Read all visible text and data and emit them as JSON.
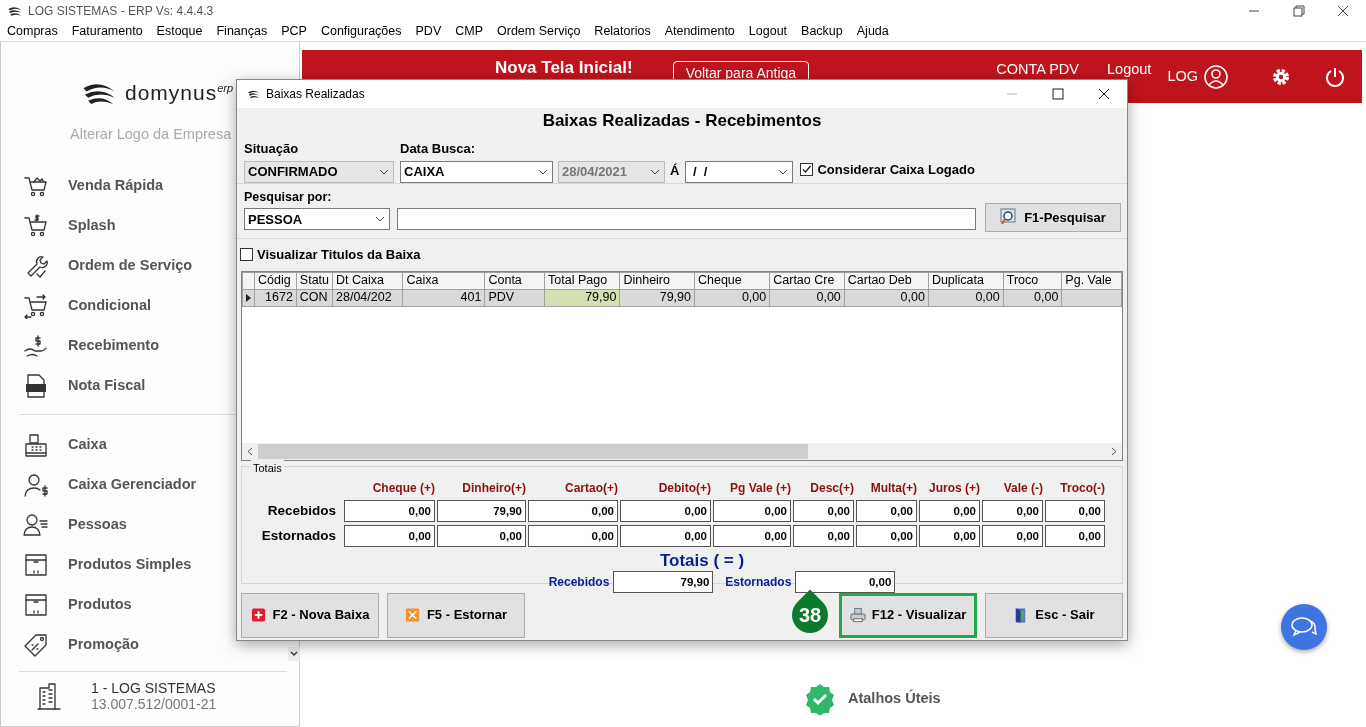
{
  "app_window": {
    "title": "LOG SISTEMAS - ERP Vs: 4.4.4.3"
  },
  "menu": [
    "Compras",
    "Faturamento",
    "Estoque",
    "Finanças",
    "PCP",
    "Configurações",
    "PDV",
    "CMP",
    "Ordem Serviço",
    "Relatorios",
    "Atendimento",
    "Logout",
    "Backup",
    "Ajuda"
  ],
  "header": {
    "banner": "Nova Tela Inicial!",
    "back_button": "Voltar para Antiga",
    "account": "CONTA PDV",
    "logout": "Logout",
    "user": "LOG"
  },
  "sidebar": {
    "logo": "domynus",
    "logo_suffix": "erp",
    "change_logo": "Alterar Logo da Empresa",
    "groups": [
      [
        "Venda Rápida",
        "Splash",
        "Ordem de Serviço",
        "Condicional",
        "Recebimento",
        "Nota Fiscal"
      ],
      [
        "Caixa",
        "Caixa Gerenciador",
        "Pessoas",
        "Produtos Simples",
        "Produtos",
        "Promoção"
      ]
    ],
    "company": {
      "name": "1 - LOG SISTEMAS",
      "cnpj": "13.007.512/0001-21"
    }
  },
  "shortcuts": {
    "label": "Atalhos Úteis"
  },
  "dialog": {
    "title": "Baixas Realizadas",
    "heading": "Baixas Realizadas - Recebimentos",
    "filters": {
      "situacao": {
        "label": "Situação",
        "value": "CONFIRMADO",
        "disabled": true
      },
      "data_busca": {
        "label": "Data Busca:",
        "value": "CAIXA"
      },
      "date_from": {
        "value": "28/04/2021",
        "disabled": true
      },
      "range_separator": "Á",
      "date_to": {
        "value": " /  /"
      },
      "logged_cash": {
        "label": "Considerar Caixa Logado",
        "checked": true
      }
    },
    "search": {
      "label": "Pesquisar por:",
      "field": "PESSOA",
      "button": "F1-Pesquisar"
    },
    "show_titles": {
      "label": "Visualizar Titulos da Baixa",
      "checked": false
    },
    "grid": {
      "columns": [
        {
          "label": "Códig",
          "kind": "number"
        },
        {
          "label": "Statu",
          "kind": "text"
        },
        {
          "label": "Dt Caixa",
          "kind": "text"
        },
        {
          "label": "Caixa",
          "kind": "number"
        },
        {
          "label": "Conta",
          "kind": "text"
        },
        {
          "label": "Total Pago",
          "kind": "number"
        },
        {
          "label": "Dinheiro",
          "kind": "number"
        },
        {
          "label": "Cheque",
          "kind": "number"
        },
        {
          "label": "Cartao Cre",
          "kind": "number"
        },
        {
          "label": "Cartao Deb",
          "kind": "number"
        },
        {
          "label": "Duplicata",
          "kind": "number"
        },
        {
          "label": "Troco",
          "kind": "number"
        },
        {
          "label": "Pg. Vale",
          "kind": "number"
        }
      ],
      "rows": [
        {
          "selected": true,
          "cells": [
            {
              "text": "1672",
              "focused": false
            },
            {
              "text": "CON",
              "focused": false
            },
            {
              "text": "28/04/202",
              "focused": false
            },
            {
              "text": "401",
              "focused": false
            },
            {
              "text": "PDV",
              "focused": false
            },
            {
              "text": "79,90",
              "focused": true
            },
            {
              "text": "79,90",
              "focused": false
            },
            {
              "text": "0,00",
              "focused": false
            },
            {
              "text": "0,00",
              "focused": false
            },
            {
              "text": "0,00",
              "focused": false
            },
            {
              "text": "0,00",
              "focused": false
            },
            {
              "text": "0,00",
              "focused": false
            }
          ]
        }
      ]
    },
    "totals": {
      "legend": "Totais",
      "columns": [
        "Cheque (+)",
        "Dinheiro(+)",
        "Cartao(+)",
        "Debito(+)",
        "Pg Vale (+)",
        "Desc(+)",
        "Multa(+)",
        "Juros (+)",
        "Vale (-)",
        "Troco(-)"
      ],
      "rows": [
        {
          "label": "Recebidos",
          "values": [
            "0,00",
            "79,90",
            "0,00",
            "0,00",
            "0,00",
            "0,00",
            "0,00",
            "0,00",
            "0,00",
            "0,00"
          ]
        },
        {
          "label": "Estornados",
          "values": [
            "0,00",
            "0,00",
            "0,00",
            "0,00",
            "0,00",
            "0,00",
            "0,00",
            "0,00",
            "0,00",
            "0,00"
          ]
        }
      ],
      "summary_title": "Totais ( = )",
      "summary": [
        {
          "label": "Recebidos",
          "value": "79,90"
        },
        {
          "label": "Estornados",
          "value": "0,00"
        }
      ]
    },
    "buttons": [
      {
        "label": "F2 - Nova Baixa",
        "kind": "add",
        "highlighted": false
      },
      {
        "label": "F5 - Estornar",
        "kind": "reverse",
        "highlighted": false
      },
      {
        "label": "F12 - Visualizar",
        "kind": "print",
        "highlighted": true,
        "badge": "38"
      },
      {
        "label": "Esc - Sair",
        "kind": "exit",
        "highlighted": false
      }
    ]
  }
}
